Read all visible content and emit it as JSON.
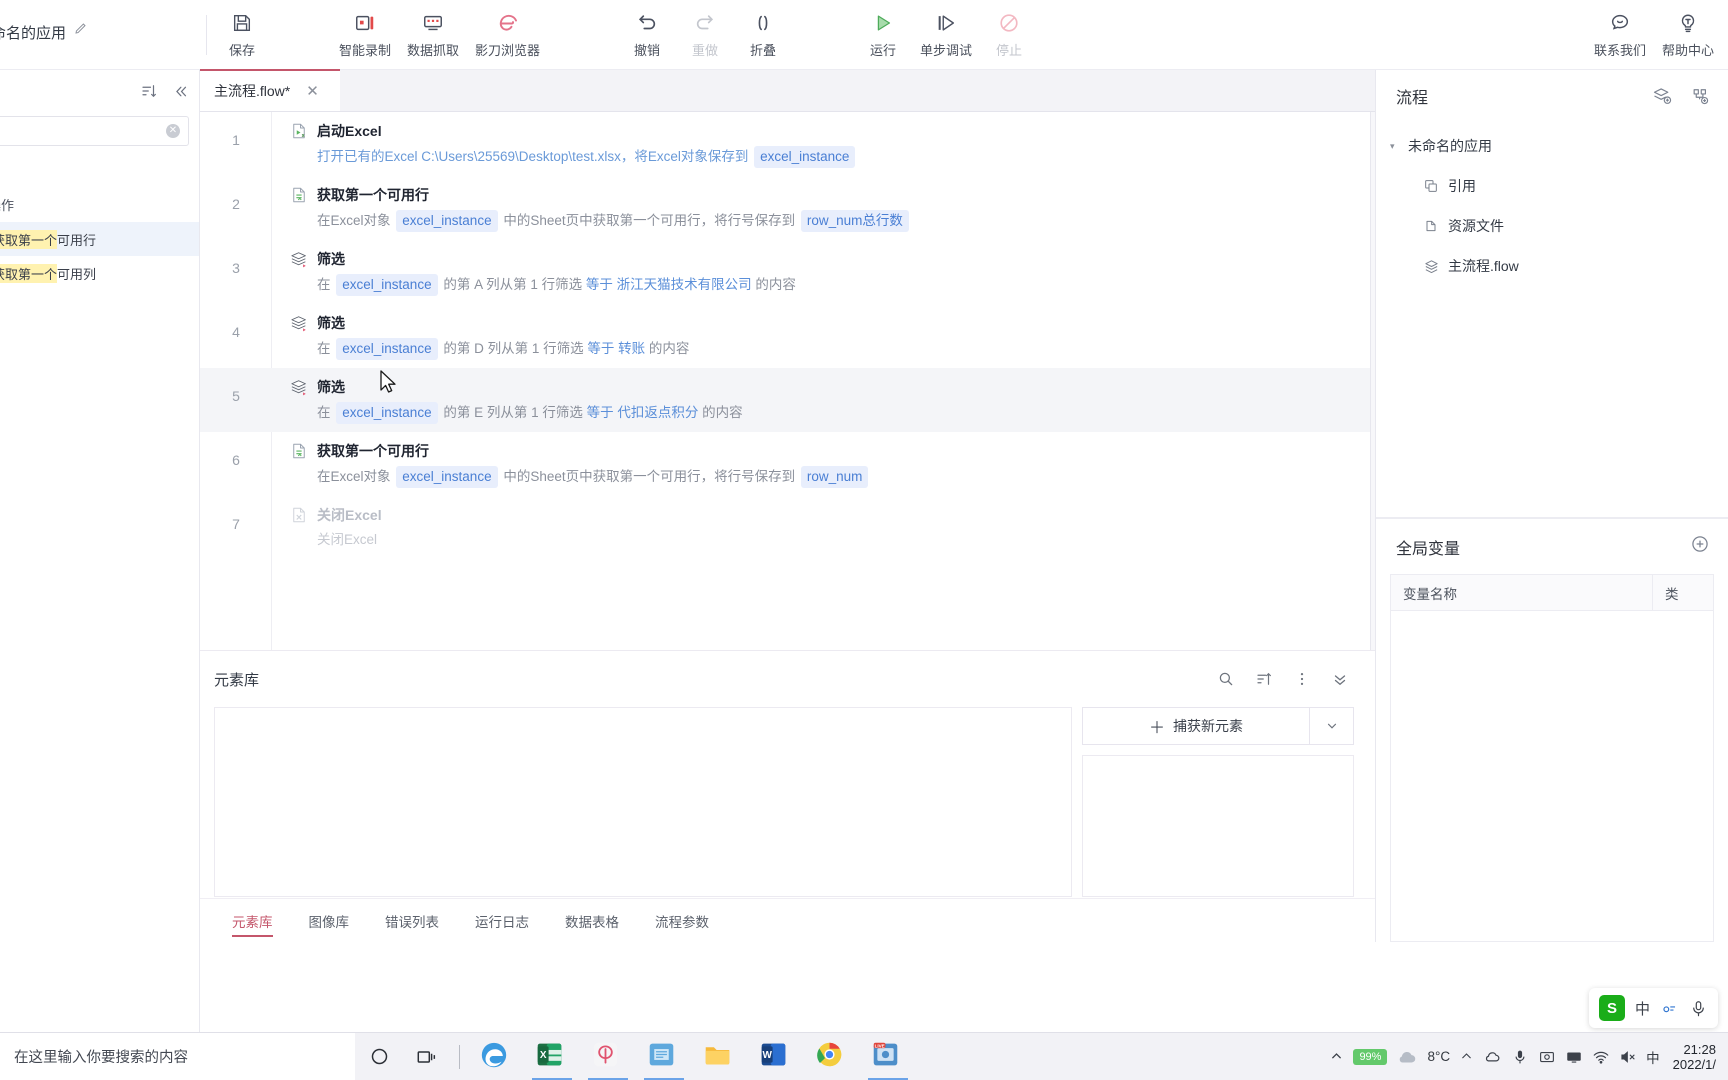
{
  "app": {
    "title": "未命名的应用",
    "edit_icon": "pencil-icon"
  },
  "toolbar": {
    "items": [
      {
        "label": "保存",
        "icon": "save-icon",
        "state": "enabled"
      },
      {
        "label": "智能录制",
        "icon": "record-icon",
        "state": "enabled"
      },
      {
        "label": "数据抓取",
        "icon": "data-capture-icon",
        "state": "enabled"
      },
      {
        "label": "影刀浏览器",
        "icon": "browser-icon",
        "state": "enabled"
      },
      {
        "label": "撤销",
        "icon": "undo-icon",
        "state": "enabled"
      },
      {
        "label": "重做",
        "icon": "redo-icon",
        "state": "disabled"
      },
      {
        "label": "折叠",
        "icon": "collapse-icon",
        "state": "enabled"
      },
      {
        "label": "运行",
        "icon": "run-icon",
        "state": "enabled"
      },
      {
        "label": "单步调试",
        "icon": "step-debug-icon",
        "state": "enabled"
      },
      {
        "label": "停止",
        "icon": "stop-icon",
        "state": "disabled"
      }
    ],
    "right_items": [
      {
        "label": "联系我们",
        "icon": "chat-icon"
      },
      {
        "label": "帮助中心",
        "icon": "help-bulb-icon"
      }
    ]
  },
  "left_panel": {
    "search_value": "",
    "search_placeholder": "",
    "section_label": "操作",
    "results": [
      {
        "highlight": "获取第一个",
        "rest": "可用行",
        "selected": true
      },
      {
        "highlight": "获取第一个",
        "rest": "可用列",
        "selected": false
      }
    ]
  },
  "editor": {
    "tab": {
      "label": "主流程.flow*",
      "close": "✕"
    },
    "steps": [
      {
        "num": "1",
        "icon": "excel-open-icon",
        "title": "启动Excel",
        "dim": false,
        "hover": false,
        "desc": [
          {
            "t": "打开已有的Excel C:\\Users\\25569\\Desktop\\test.xlsx，将Excel对象保存到 ",
            "k": "link"
          },
          {
            "t": "excel_instance",
            "k": "chip"
          }
        ]
      },
      {
        "num": "2",
        "icon": "excel-row-icon",
        "title": "获取第一个可用行",
        "dim": false,
        "hover": false,
        "desc": [
          {
            "t": "在Excel对象 ",
            "k": "plain"
          },
          {
            "t": "excel_instance",
            "k": "chip"
          },
          {
            "t": " 中的Sheet页中获取第一个可用行，将行号保存到 ",
            "k": "plain"
          },
          {
            "t": "row_num总行数",
            "k": "chip"
          }
        ]
      },
      {
        "num": "3",
        "icon": "filter-icon",
        "title": "筛选",
        "dim": false,
        "hover": false,
        "desc": [
          {
            "t": "在 ",
            "k": "plain"
          },
          {
            "t": "excel_instance",
            "k": "chip"
          },
          {
            "t": " 的第 A 列从第 1 行筛选 ",
            "k": "plain"
          },
          {
            "t": "等于",
            "k": "blue"
          },
          {
            "t": " ",
            "k": "plain"
          },
          {
            "t": "浙江天猫技术有限公司",
            "k": "blue"
          },
          {
            "t": " 的内容",
            "k": "plain"
          }
        ]
      },
      {
        "num": "4",
        "icon": "filter-icon",
        "title": "筛选",
        "dim": false,
        "hover": false,
        "desc": [
          {
            "t": "在 ",
            "k": "plain"
          },
          {
            "t": "excel_instance",
            "k": "chip"
          },
          {
            "t": " 的第 D 列从第 1 行筛选 ",
            "k": "plain"
          },
          {
            "t": "等于",
            "k": "blue"
          },
          {
            "t": " ",
            "k": "plain"
          },
          {
            "t": "转账",
            "k": "blue"
          },
          {
            "t": " 的内容",
            "k": "plain"
          }
        ]
      },
      {
        "num": "5",
        "icon": "filter-icon",
        "title": "筛选",
        "dim": false,
        "hover": true,
        "desc": [
          {
            "t": "在 ",
            "k": "plain"
          },
          {
            "t": "excel_instance",
            "k": "chip"
          },
          {
            "t": " 的第 E 列从第 1 行筛选 ",
            "k": "plain"
          },
          {
            "t": "等于",
            "k": "blue"
          },
          {
            "t": " ",
            "k": "plain"
          },
          {
            "t": "代扣返点积分",
            "k": "blue"
          },
          {
            "t": " 的内容",
            "k": "plain"
          }
        ]
      },
      {
        "num": "6",
        "icon": "excel-row-icon",
        "title": "获取第一个可用行",
        "dim": false,
        "hover": false,
        "desc": [
          {
            "t": "在Excel对象 ",
            "k": "plain"
          },
          {
            "t": "excel_instance",
            "k": "chip"
          },
          {
            "t": " 中的Sheet页中获取第一个可用行，将行号保存到 ",
            "k": "plain"
          },
          {
            "t": "row_num",
            "k": "chip"
          }
        ]
      },
      {
        "num": "7",
        "icon": "excel-close-icon",
        "title": "关闭Excel",
        "dim": true,
        "hover": false,
        "desc": [
          {
            "t": "关闭Excel",
            "k": "dim"
          }
        ]
      }
    ]
  },
  "bottom_panel": {
    "title": "元素库",
    "tools": [
      {
        "icon": "search-icon"
      },
      {
        "icon": "sort-icon"
      },
      {
        "icon": "more-vertical-icon"
      },
      {
        "icon": "chevron-double-down-icon"
      }
    ],
    "capture_button": "捕获新元素",
    "capture_caret": "chevron-down-icon",
    "tabs": [
      {
        "label": "元素库",
        "active": true
      },
      {
        "label": "图像库",
        "active": false
      },
      {
        "label": "错误列表",
        "active": false
      },
      {
        "label": "运行日志",
        "active": false
      },
      {
        "label": "数据表格",
        "active": false
      },
      {
        "label": "流程参数",
        "active": false
      }
    ]
  },
  "right_panel": {
    "flow_title": "流程",
    "flow_actions": [
      {
        "icon": "add-layer-icon"
      },
      {
        "icon": "add-module-icon"
      }
    ],
    "tree": {
      "root": {
        "label": "未命名的应用",
        "caret": "▾"
      },
      "children": [
        {
          "label": "引用",
          "icon": "reference-icon"
        },
        {
          "label": "资源文件",
          "icon": "resource-file-icon"
        },
        {
          "label": "主流程.flow",
          "icon": "flow-file-icon"
        }
      ]
    },
    "global_vars": {
      "title": "全局变量",
      "add_icon": "plus-circle-icon",
      "columns": [
        "变量名称",
        "类"
      ],
      "rows": []
    }
  },
  "taskbar": {
    "search_placeholder": "在这里输入你要搜索的内容",
    "buttons": [
      {
        "icon": "cortana-icon"
      },
      {
        "icon": "task-view-icon"
      }
    ],
    "apps": [
      {
        "icon": "edge-icon",
        "active": false
      },
      {
        "icon": "excel-icon",
        "active": true
      },
      {
        "icon": "yingdao-icon",
        "active": true
      },
      {
        "icon": "explorer-blue-icon",
        "active": true
      },
      {
        "icon": "file-explorer-icon",
        "active": false
      },
      {
        "icon": "word-icon",
        "active": false
      },
      {
        "icon": "chrome-icon",
        "active": false
      },
      {
        "icon": "live-app-icon",
        "active": true
      }
    ],
    "tray": {
      "battery": "99%",
      "weather_icon": "cloud-icon",
      "temperature": "8°C",
      "icons": [
        "chevron-up-icon",
        "cloud-icon",
        "mic-icon",
        "screenshot-icon",
        "monitor-icon",
        "wifi-icon",
        "volume-mute-icon",
        "ime-cn-icon"
      ],
      "clock_time": "21:28",
      "clock_date": "2022/1/"
    }
  },
  "ime_bar": {
    "logo": "S",
    "items": [
      "中",
      "keyboard-icon",
      "mic-icon"
    ]
  }
}
